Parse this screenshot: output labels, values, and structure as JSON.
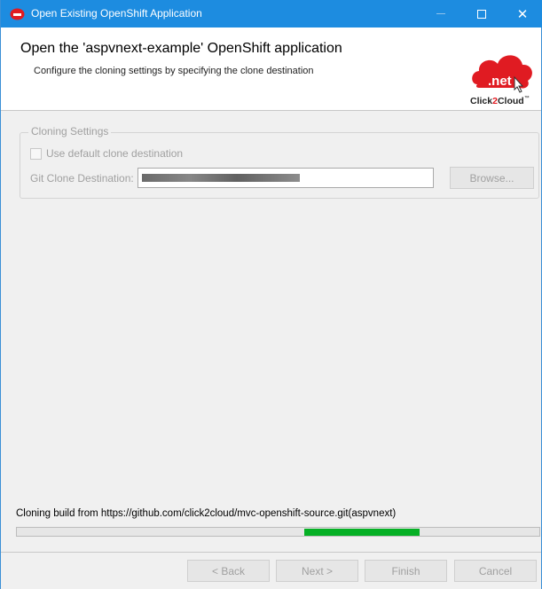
{
  "window": {
    "title": "Open Existing OpenShift Application",
    "controls": {
      "minimize": "minimize",
      "maximize": "maximize",
      "close": "✕"
    }
  },
  "header": {
    "heading": "Open the 'aspvnext-example' OpenShift application",
    "subtext": "Configure the cloning settings by specifying the clone destination",
    "logo": {
      "badge": ".net",
      "brand_prefix": "Click",
      "brand_accent": "2",
      "brand_suffix": "Cloud",
      "tm": "™"
    }
  },
  "cloning": {
    "legend": "Cloning Settings",
    "use_default_label": "Use default clone destination",
    "use_default_checked": false,
    "destination_label": "Git Clone Destination:",
    "destination_value": "",
    "browse_label": "Browse..."
  },
  "status": {
    "message": "Cloning build from https://github.com/click2cloud/mvc-openshift-source.git(aspvnext)",
    "progress": {
      "start": 0.55,
      "end": 0.77,
      "color": "#06b025"
    }
  },
  "footer": {
    "back": "< Back",
    "next": "Next >",
    "finish": "Finish",
    "cancel": "Cancel"
  },
  "colors": {
    "titlebar": "#1d8ce0",
    "logo_red": "#e01b22",
    "disabled_text": "#a0a0a0"
  }
}
